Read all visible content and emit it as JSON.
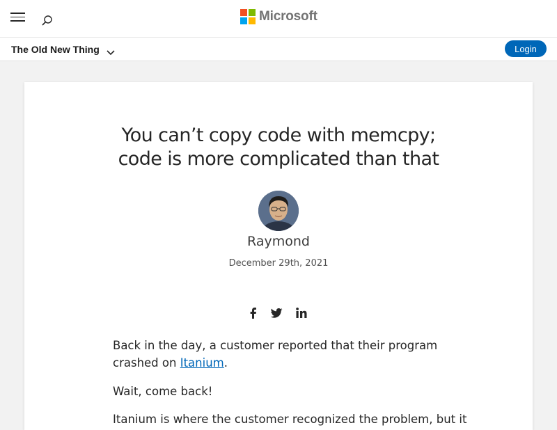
{
  "header": {
    "menu_icon": "hamburger-menu-icon",
    "search_icon": "search-icon",
    "brand_name": "Microsoft",
    "brand_colors": [
      "#f25022",
      "#7fba00",
      "#00a4ef",
      "#ffb900"
    ]
  },
  "subnav": {
    "blog_title": "The Old New Thing",
    "dropdown_icon": "chevron-down-icon",
    "login_label": "Login",
    "accent_color": "#0067b8"
  },
  "post": {
    "title_line1": "You can’t copy code with memcpy;",
    "title_line2": "code is more complicated than that",
    "author": "Raymond",
    "date": "December 29th, 2021",
    "share_icons": [
      "facebook-icon",
      "twitter-icon",
      "linkedin-icon"
    ],
    "paragraph1_before": "Back in the day, a customer reported that their program crashed on ",
    "paragraph1_link": "Itanium",
    "paragraph1_after": ".",
    "paragraph2": "Wait, come back!",
    "paragraph3_partial": "Itanium is where the customer recognized the problem, but it"
  }
}
